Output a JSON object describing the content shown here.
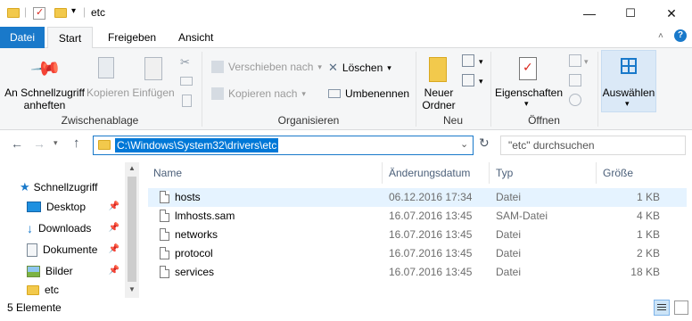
{
  "window": {
    "title": "etc",
    "minimize": "—",
    "maximize": "☐",
    "close": "✕"
  },
  "tabs": {
    "file": "Datei",
    "home": "Start",
    "share": "Freigeben",
    "view": "Ansicht"
  },
  "ribbon": {
    "pin_quick": [
      "An Schnellzugriff",
      "anheften"
    ],
    "copy": "Kopieren",
    "paste": "Einfügen",
    "clipboard_group": "Zwischenablage",
    "move_to": "Verschieben nach",
    "copy_to": "Kopieren nach",
    "delete": "Löschen",
    "rename": "Umbenennen",
    "organize_group": "Organisieren",
    "new_folder": [
      "Neuer",
      "Ordner"
    ],
    "new_group": "Neu",
    "properties": "Eigenschaften",
    "open_group": "Öffnen",
    "select": "Auswählen"
  },
  "address": {
    "path": "C:\\Windows\\System32\\drivers\\etc",
    "search_placeholder": "\"etc\" durchsuchen"
  },
  "nav": {
    "items": [
      {
        "label": "Schnellzugriff"
      },
      {
        "label": "Desktop"
      },
      {
        "label": "Downloads"
      },
      {
        "label": "Dokumente"
      },
      {
        "label": "Bilder"
      },
      {
        "label": "etc"
      }
    ]
  },
  "list": {
    "columns": [
      "Name",
      "Änderungsdatum",
      "Typ",
      "Größe"
    ],
    "rows": [
      {
        "name": "hosts",
        "date": "06.12.2016 17:34",
        "type": "Datei",
        "size": "1 KB"
      },
      {
        "name": "lmhosts.sam",
        "date": "16.07.2016 13:45",
        "type": "SAM-Datei",
        "size": "4 KB"
      },
      {
        "name": "networks",
        "date": "16.07.2016 13:45",
        "type": "Datei",
        "size": "1 KB"
      },
      {
        "name": "protocol",
        "date": "16.07.2016 13:45",
        "type": "Datei",
        "size": "2 KB"
      },
      {
        "name": "services",
        "date": "16.07.2016 13:45",
        "type": "Datei",
        "size": "18 KB"
      }
    ]
  },
  "status": {
    "count": "5 Elemente"
  }
}
